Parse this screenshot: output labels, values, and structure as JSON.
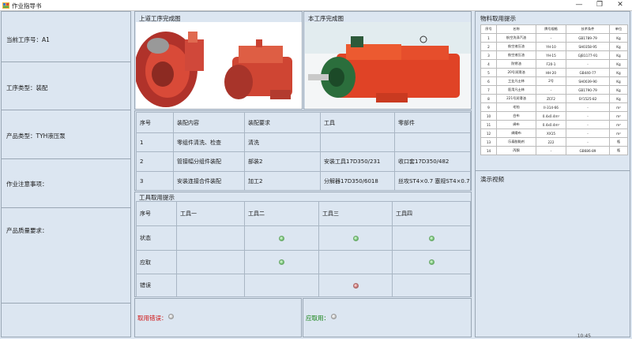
{
  "window": {
    "title": "作业指导书",
    "btn_min": "—",
    "btn_max": "❐",
    "btn_close": "✕"
  },
  "left": {
    "current_step": "当前工序号：A1",
    "step_type": "工序类型：装配",
    "product_type": "产品类型：TYH液压泵",
    "notes": "作业注意事项：",
    "quality": "产品质量要求："
  },
  "images": {
    "prev_caption": "上道工序完成图",
    "curr_caption": "本工序完成图"
  },
  "assembly": {
    "headers": [
      "序号",
      "装配内容",
      "装配要求",
      "工具",
      "零部件"
    ],
    "rows": [
      [
        "1",
        "零组件清洗、检查",
        "清洗",
        "",
        ""
      ],
      [
        "2",
        "管接幅分组件装配",
        "部装2",
        "安装工具17D350/231",
        "收口套17D350/482"
      ],
      [
        "3",
        "安装连接合件装配",
        "加工2",
        "分解器17D350/6018",
        "丝攻ST4×0.7 塞规ST4×0.7"
      ]
    ]
  },
  "tools": {
    "caption": "工具取用提示",
    "headers": [
      "序号",
      "工具一",
      "工具二",
      "工具三",
      "工具四"
    ],
    "rows": [
      {
        "label": "状态",
        "leds": [
          "",
          "green",
          "green",
          "green"
        ]
      },
      {
        "label": "应取",
        "leds": [
          "",
          "green",
          "",
          "green"
        ]
      },
      {
        "label": "错误",
        "leds": [
          "",
          "",
          "red",
          ""
        ]
      }
    ]
  },
  "status": {
    "error_label": "取用错误：",
    "should_label": "应取用："
  },
  "materials": {
    "caption": "物料取用提示",
    "headers": [
      "序号",
      "名称",
      "牌号规格",
      "技术条件",
      "单位"
    ],
    "rows": [
      [
        "1",
        "航空洗涤汽油",
        "-",
        "GB1789-79",
        "Kg"
      ],
      [
        "2",
        "航空液压油",
        "YH-10",
        "SH0358-95",
        "Kg"
      ],
      [
        "3",
        "航空液压油",
        "YH-15",
        "GJB1177-91",
        "Kg"
      ],
      [
        "4",
        "防锈油",
        "F20-1",
        "-",
        "Kg"
      ],
      [
        "5",
        "20号润滑油",
        "HH-20",
        "GB440-77",
        "Kg"
      ],
      [
        "6",
        "工业凡士林",
        "2号",
        "SH0039-90",
        "Kg"
      ],
      [
        "7",
        "医用凡士林",
        "-",
        "GB1790-79",
        "Kg"
      ],
      [
        "8",
        "221号润滑油",
        "ZCF2",
        "SY1525-82",
        "Kg"
      ],
      [
        "9",
        "毛毡",
        "II-314-66",
        "-",
        "m²"
      ],
      [
        "10",
        "白布",
        "0.4x0.4m²",
        "-",
        "m²"
      ],
      [
        "11",
        "绸布",
        "0.4x0.4m²",
        "-",
        "m²"
      ],
      [
        "12",
        "绸缎布",
        "XX15",
        "-",
        "m²"
      ],
      [
        "13",
        "乐泰胶黏剂",
        "222",
        "-",
        "瓶"
      ],
      [
        "14",
        "丙酮",
        "-",
        "GB686-89",
        "瓶"
      ]
    ],
    "video_caption": "演示视频"
  },
  "taskbar": {
    "clock": "10:45"
  }
}
